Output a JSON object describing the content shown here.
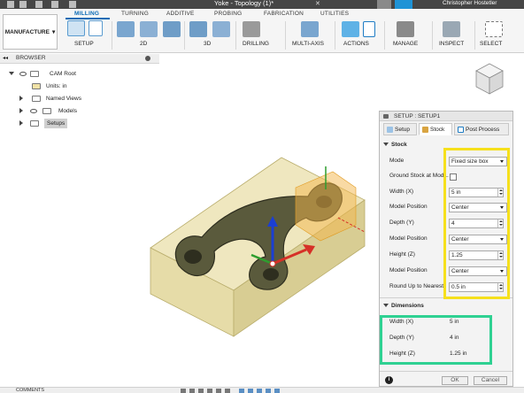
{
  "titlebar": {
    "document_title": "Yoke - Topology (1)*",
    "close_glyph": "✕",
    "user_name": "Christopher Hostetler"
  },
  "ribbon": {
    "workspace_label": "MANUFACTURE",
    "tabs": [
      "MILLING",
      "TURNING",
      "ADDITIVE",
      "PROBING",
      "FABRICATION",
      "UTILITIES"
    ],
    "groups": [
      "SETUP",
      "2D",
      "3D",
      "DRILLING",
      "MULTI-AXIS",
      "ACTIONS",
      "MANAGE",
      "INSPECT",
      "SELECT"
    ],
    "accent_color": "#0a6bb5"
  },
  "browser": {
    "title": "BROWSER",
    "items": [
      {
        "label": "CAM Root"
      },
      {
        "label": "Units: in"
      },
      {
        "label": "Named Views"
      },
      {
        "label": "Models"
      },
      {
        "label": "Setups"
      }
    ]
  },
  "dialog": {
    "title": "SETUP : SETUP1",
    "tabs": [
      "Setup",
      "Stock",
      "Post Process"
    ],
    "stock_section": "Stock",
    "rows": {
      "mode_label": "Mode",
      "mode_value": "Fixed size box",
      "ground_label": "Ground Stock at Mod...",
      "width_label": "Width (X)",
      "width_value": "5 in",
      "model_pos_label": "Model Position",
      "model_pos_x_value": "Center",
      "depth_label": "Depth (Y)",
      "depth_value": "4",
      "model_pos_y_value": "Center",
      "height_label": "Height (Z)",
      "height_value": "1.25",
      "model_pos_z_value": "Center",
      "round_label": "Round Up to Nearest",
      "round_value": "0.5 in"
    },
    "dimensions_section": "Dimensions",
    "dimensions": {
      "width_label": "Width (X)",
      "width_value": "5 in",
      "depth_label": "Depth (Y)",
      "depth_value": "4 in",
      "height_label": "Height (Z)",
      "height_value": "1.25 in"
    },
    "ok_label": "OK",
    "cancel_label": "Cancel",
    "info_glyph": "i"
  },
  "bottom": {
    "comments_label": "COMMENTS"
  },
  "colors": {
    "highlight_yellow": "#f6e01c",
    "highlight_green": "#2fd192",
    "stock_fill": "#e8e0b0",
    "part_fill": "#5a5a3c"
  }
}
